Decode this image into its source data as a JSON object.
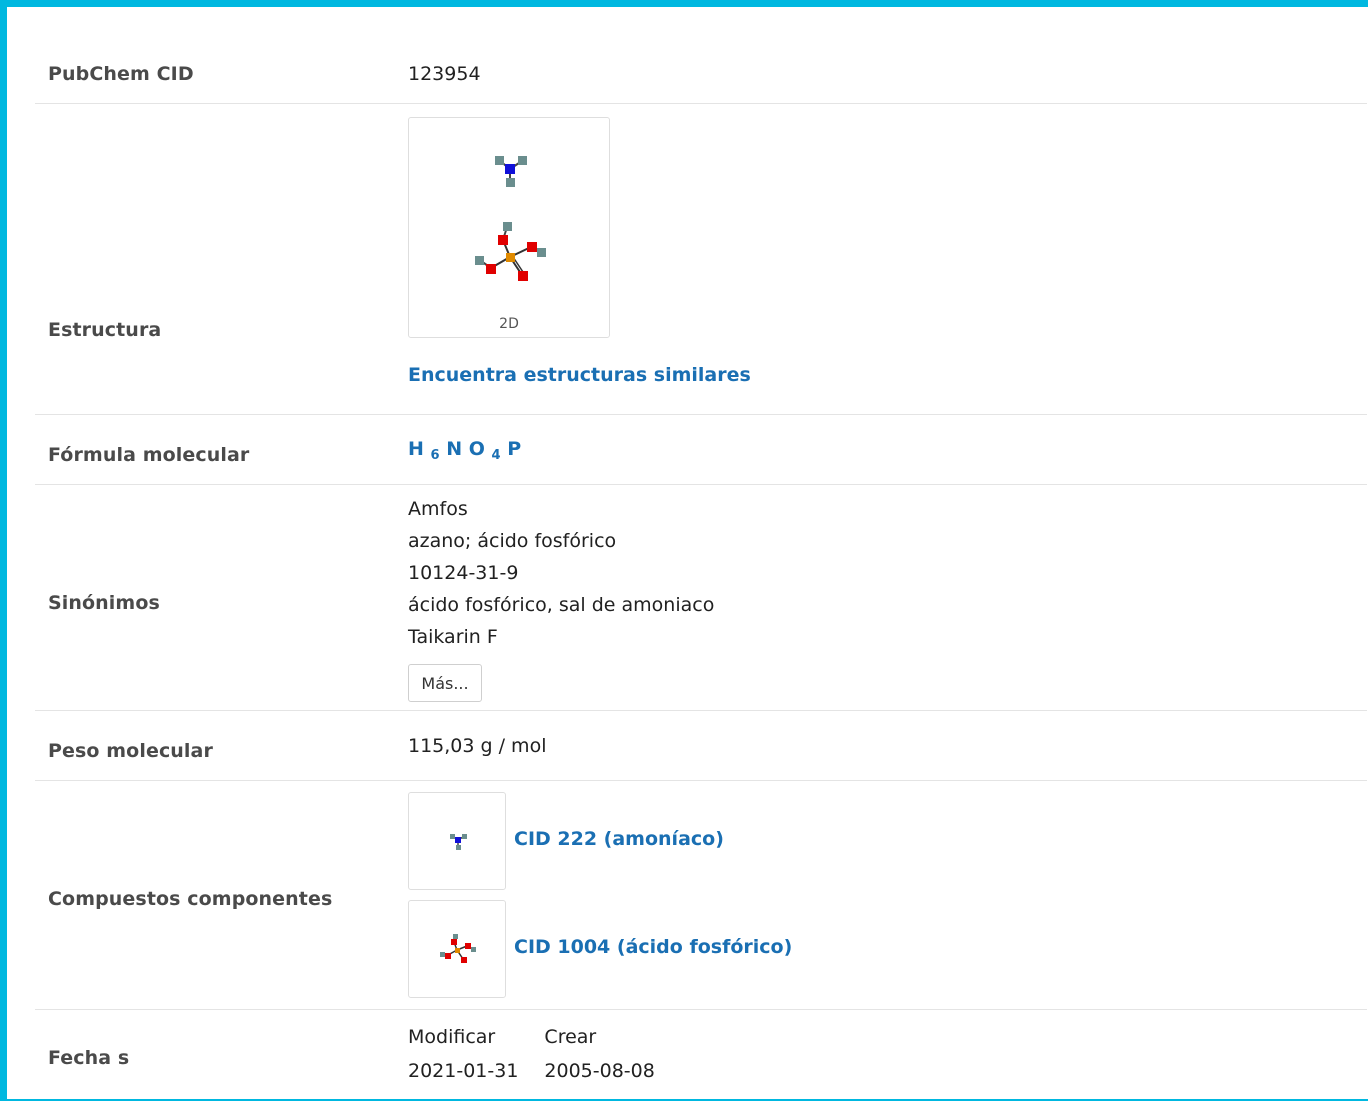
{
  "rows": {
    "cid": {
      "label": "PubChem CID",
      "value": "123954"
    },
    "structure": {
      "label": "Estructura",
      "caption": "2D",
      "similar_link": "Encuentra estructuras similares"
    },
    "formula": {
      "label": "Fórmula molecular",
      "parts": {
        "h": "H",
        "h_sub": "6",
        "n": "N",
        "o": "O",
        "o_sub": "4",
        "p": "P"
      }
    },
    "synonyms": {
      "label": "Sinónimos",
      "items": [
        "Amfos",
        "azano; ácido fosfórico",
        "10124-31-9",
        "ácido fosfórico, sal de amoniaco",
        "Taikarin F"
      ],
      "more_button": "Más..."
    },
    "weight": {
      "label": "Peso molecular",
      "value": "115,03 g / mol"
    },
    "components": {
      "label": "Compuestos componentes",
      "items": [
        {
          "link": "CID 222 (amoníaco)",
          "icon": "ammonia-structure-icon"
        },
        {
          "link": "CID 1004 (ácido fosfórico)",
          "icon": "phosphoric-acid-structure-icon"
        }
      ]
    },
    "dates": {
      "label": "Fecha s",
      "headers": [
        "Modificar",
        "Crear"
      ],
      "values": [
        "2021-01-31",
        "2005-08-08"
      ]
    }
  },
  "colors": {
    "accent_border": "#00b8e0",
    "link": "#1a6fb3",
    "nitrogen": "#1010d8",
    "oxygen": "#e00000",
    "phosphorus": "#e08a00",
    "hydrogen": "#6a8e8e"
  }
}
